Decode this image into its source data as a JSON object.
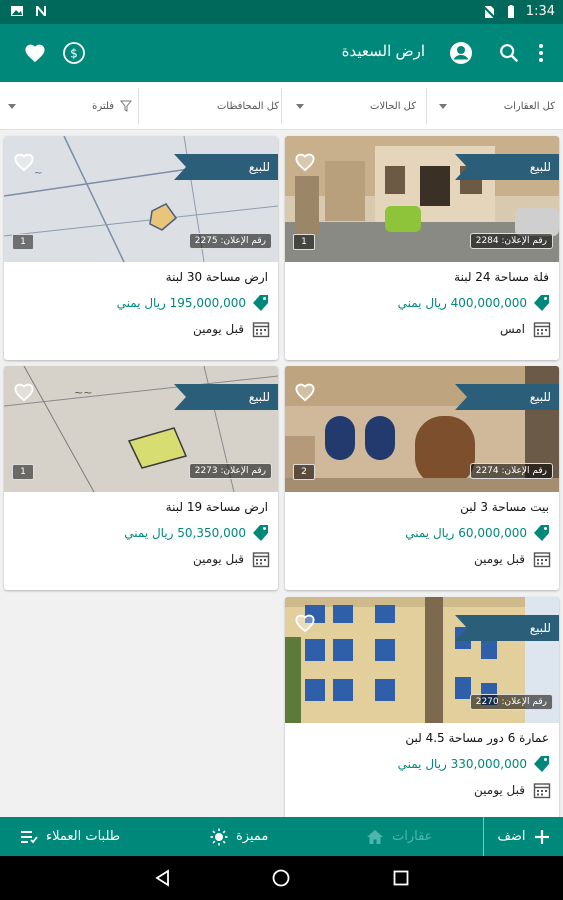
{
  "status_bar": {
    "time": "1:34",
    "left_icons": [
      "gallery-icon",
      "n-icon"
    ],
    "right_icons": [
      "no-sim-icon",
      "battery-icon"
    ]
  },
  "app_bar": {
    "title": "ارض السعيدة",
    "icons": [
      "more-vert-icon",
      "search-icon",
      "account-icon",
      "dollar-icon",
      "heart-icon"
    ]
  },
  "filters": {
    "type": "كل العقارات",
    "status": "كل الحالات",
    "province": "كل المحافظات",
    "filter_label": "فلترة"
  },
  "listings": [
    {
      "badge": "للبيع",
      "ad_number": "رقم الإعلان: 2284",
      "images": "1",
      "title": "فلة  مساحة 24 لبنة",
      "price": "400,000,000 ريال يمني",
      "date": "امس"
    },
    {
      "badge": "للبيع",
      "ad_number": "رقم الإعلان: 2275",
      "images": "1",
      "title": "ارض  مساحة 30 لبنة",
      "price": "195,000,000 ريال يمني",
      "date": "قبل يومين"
    },
    {
      "badge": "للبيع",
      "ad_number": "رقم الإعلان: 2274",
      "images": "2",
      "title": "بيت  مساحة 3 لبن",
      "price": "60,000,000 ريال يمني",
      "date": "قبل يومين"
    },
    {
      "badge": "للبيع",
      "ad_number": "رقم الإعلان: 2273",
      "images": "1",
      "title": "ارض  مساحة 19 لبنة",
      "price": "50,350,000 ريال يمني",
      "date": "قبل يومين"
    },
    {
      "badge": "للبيع",
      "ad_number": "رقم الإعلان: 2270",
      "images": "",
      "title": "عمارة 6 دور مساحة 4.5 لبن",
      "price": "330,000,000 ريال يمني",
      "date": "قبل يومين"
    }
  ],
  "bottom_nav": {
    "add": "اضف",
    "properties": "عقارات",
    "featured": "مميزة",
    "requests": "طلبات العملاء"
  },
  "colors": {
    "primary": "#00897b",
    "primary_dark": "#00695c",
    "ribbon": "#2b5e78",
    "price": "#00897b"
  }
}
